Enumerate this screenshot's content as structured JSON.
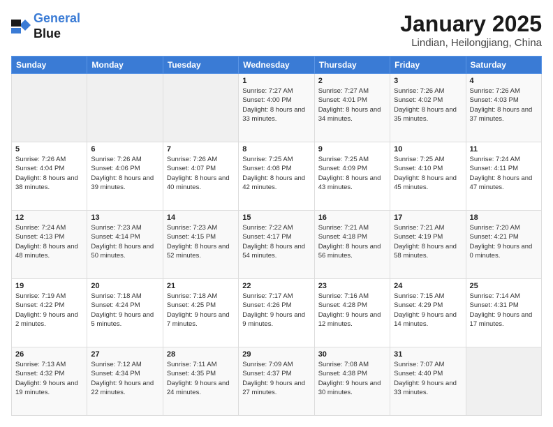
{
  "header": {
    "logo_line1": "General",
    "logo_line2": "Blue",
    "month": "January 2025",
    "location": "Lindian, Heilongjiang, China"
  },
  "weekdays": [
    "Sunday",
    "Monday",
    "Tuesday",
    "Wednesday",
    "Thursday",
    "Friday",
    "Saturday"
  ],
  "weeks": [
    [
      {
        "day": "",
        "info": ""
      },
      {
        "day": "",
        "info": ""
      },
      {
        "day": "",
        "info": ""
      },
      {
        "day": "1",
        "info": "Sunrise: 7:27 AM\nSunset: 4:00 PM\nDaylight: 8 hours\nand 33 minutes."
      },
      {
        "day": "2",
        "info": "Sunrise: 7:27 AM\nSunset: 4:01 PM\nDaylight: 8 hours\nand 34 minutes."
      },
      {
        "day": "3",
        "info": "Sunrise: 7:26 AM\nSunset: 4:02 PM\nDaylight: 8 hours\nand 35 minutes."
      },
      {
        "day": "4",
        "info": "Sunrise: 7:26 AM\nSunset: 4:03 PM\nDaylight: 8 hours\nand 37 minutes."
      }
    ],
    [
      {
        "day": "5",
        "info": "Sunrise: 7:26 AM\nSunset: 4:04 PM\nDaylight: 8 hours\nand 38 minutes."
      },
      {
        "day": "6",
        "info": "Sunrise: 7:26 AM\nSunset: 4:06 PM\nDaylight: 8 hours\nand 39 minutes."
      },
      {
        "day": "7",
        "info": "Sunrise: 7:26 AM\nSunset: 4:07 PM\nDaylight: 8 hours\nand 40 minutes."
      },
      {
        "day": "8",
        "info": "Sunrise: 7:25 AM\nSunset: 4:08 PM\nDaylight: 8 hours\nand 42 minutes."
      },
      {
        "day": "9",
        "info": "Sunrise: 7:25 AM\nSunset: 4:09 PM\nDaylight: 8 hours\nand 43 minutes."
      },
      {
        "day": "10",
        "info": "Sunrise: 7:25 AM\nSunset: 4:10 PM\nDaylight: 8 hours\nand 45 minutes."
      },
      {
        "day": "11",
        "info": "Sunrise: 7:24 AM\nSunset: 4:11 PM\nDaylight: 8 hours\nand 47 minutes."
      }
    ],
    [
      {
        "day": "12",
        "info": "Sunrise: 7:24 AM\nSunset: 4:13 PM\nDaylight: 8 hours\nand 48 minutes."
      },
      {
        "day": "13",
        "info": "Sunrise: 7:23 AM\nSunset: 4:14 PM\nDaylight: 8 hours\nand 50 minutes."
      },
      {
        "day": "14",
        "info": "Sunrise: 7:23 AM\nSunset: 4:15 PM\nDaylight: 8 hours\nand 52 minutes."
      },
      {
        "day": "15",
        "info": "Sunrise: 7:22 AM\nSunset: 4:17 PM\nDaylight: 8 hours\nand 54 minutes."
      },
      {
        "day": "16",
        "info": "Sunrise: 7:21 AM\nSunset: 4:18 PM\nDaylight: 8 hours\nand 56 minutes."
      },
      {
        "day": "17",
        "info": "Sunrise: 7:21 AM\nSunset: 4:19 PM\nDaylight: 8 hours\nand 58 minutes."
      },
      {
        "day": "18",
        "info": "Sunrise: 7:20 AM\nSunset: 4:21 PM\nDaylight: 9 hours\nand 0 minutes."
      }
    ],
    [
      {
        "day": "19",
        "info": "Sunrise: 7:19 AM\nSunset: 4:22 PM\nDaylight: 9 hours\nand 2 minutes."
      },
      {
        "day": "20",
        "info": "Sunrise: 7:18 AM\nSunset: 4:24 PM\nDaylight: 9 hours\nand 5 minutes."
      },
      {
        "day": "21",
        "info": "Sunrise: 7:18 AM\nSunset: 4:25 PM\nDaylight: 9 hours\nand 7 minutes."
      },
      {
        "day": "22",
        "info": "Sunrise: 7:17 AM\nSunset: 4:26 PM\nDaylight: 9 hours\nand 9 minutes."
      },
      {
        "day": "23",
        "info": "Sunrise: 7:16 AM\nSunset: 4:28 PM\nDaylight: 9 hours\nand 12 minutes."
      },
      {
        "day": "24",
        "info": "Sunrise: 7:15 AM\nSunset: 4:29 PM\nDaylight: 9 hours\nand 14 minutes."
      },
      {
        "day": "25",
        "info": "Sunrise: 7:14 AM\nSunset: 4:31 PM\nDaylight: 9 hours\nand 17 minutes."
      }
    ],
    [
      {
        "day": "26",
        "info": "Sunrise: 7:13 AM\nSunset: 4:32 PM\nDaylight: 9 hours\nand 19 minutes."
      },
      {
        "day": "27",
        "info": "Sunrise: 7:12 AM\nSunset: 4:34 PM\nDaylight: 9 hours\nand 22 minutes."
      },
      {
        "day": "28",
        "info": "Sunrise: 7:11 AM\nSunset: 4:35 PM\nDaylight: 9 hours\nand 24 minutes."
      },
      {
        "day": "29",
        "info": "Sunrise: 7:09 AM\nSunset: 4:37 PM\nDaylight: 9 hours\nand 27 minutes."
      },
      {
        "day": "30",
        "info": "Sunrise: 7:08 AM\nSunset: 4:38 PM\nDaylight: 9 hours\nand 30 minutes."
      },
      {
        "day": "31",
        "info": "Sunrise: 7:07 AM\nSunset: 4:40 PM\nDaylight: 9 hours\nand 33 minutes."
      },
      {
        "day": "",
        "info": ""
      }
    ]
  ]
}
